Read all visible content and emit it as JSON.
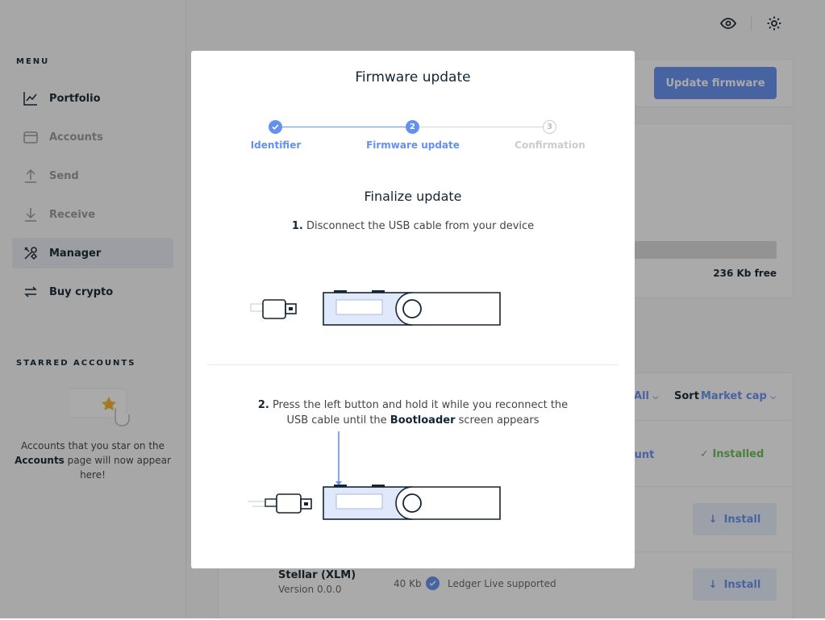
{
  "sidebar": {
    "menu_label": "MENU",
    "items": [
      {
        "label": "Portfolio",
        "icon": "chart-icon"
      },
      {
        "label": "Accounts",
        "icon": "wallet-icon"
      },
      {
        "label": "Send",
        "icon": "send-icon"
      },
      {
        "label": "Receive",
        "icon": "receive-icon"
      },
      {
        "label": "Manager",
        "icon": "tools-icon"
      },
      {
        "label": "Buy crypto",
        "icon": "exchange-icon"
      }
    ],
    "starred_label": "STARRED ACCOUNTS",
    "starred_text_before": "Accounts that you star on the ",
    "starred_text_bold": "Accounts",
    "starred_text_after": " page will now appear here!"
  },
  "main": {
    "update_firmware_label": "Update firmware",
    "storage_free": "236 Kb free",
    "filter_all": "All",
    "sort_label": "Sort",
    "sort_value": "Market cap",
    "account_link": "count",
    "installed_label": "Installed",
    "install_label": "Install",
    "app_name": "Stellar (XLM)",
    "app_version": "Version 0.0.0",
    "app_size": "40 Kb",
    "app_supported": "Ledger Live supported"
  },
  "modal": {
    "title": "Firmware update",
    "steps": [
      {
        "number": "1",
        "label": "Identifier",
        "state": "done"
      },
      {
        "number": "2",
        "label": "Firmware update",
        "state": "active"
      },
      {
        "number": "3",
        "label": "Confirmation",
        "state": "pending"
      }
    ],
    "heading": "Finalize update",
    "step1_num": "1.",
    "step1_text": "Disconnect the USB cable from your device",
    "step2_num": "2.",
    "step2_text_a": "Press the left button and hold it while you reconnect the USB cable until the ",
    "step2_bold": "Bootloader",
    "step2_text_b": " screen appears"
  },
  "colors": {
    "accent": "#6490f1",
    "success": "#66be54",
    "text": "#142533",
    "muted": "#999999"
  }
}
